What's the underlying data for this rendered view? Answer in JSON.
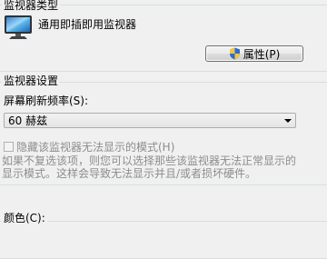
{
  "monitor_type_group": {
    "title": "监视器类型",
    "monitor_name": "通用即插即用监视器",
    "properties_button_label": "属性(P)"
  },
  "monitor_settings_group": {
    "title": "监视器设置",
    "refresh_rate_label": "屏幕刷新频率(S):",
    "refresh_rate_value": "60 赫兹",
    "hide_modes_checkbox_label": "隐藏该监视器无法显示的模式(H)",
    "hide_modes_checked": false,
    "description_line1": "如果不复选该项，则您可以选择那些该监视器无法正常显示的",
    "description_line2": "显示模式。这样会导致无法显示并且/或者损坏硬件。"
  },
  "colors_group": {
    "title": "颜色(C):"
  },
  "icons": {
    "monitor": "monitor-icon",
    "shield": "uac-shield-icon",
    "dropdown": "chevron-down-icon"
  }
}
